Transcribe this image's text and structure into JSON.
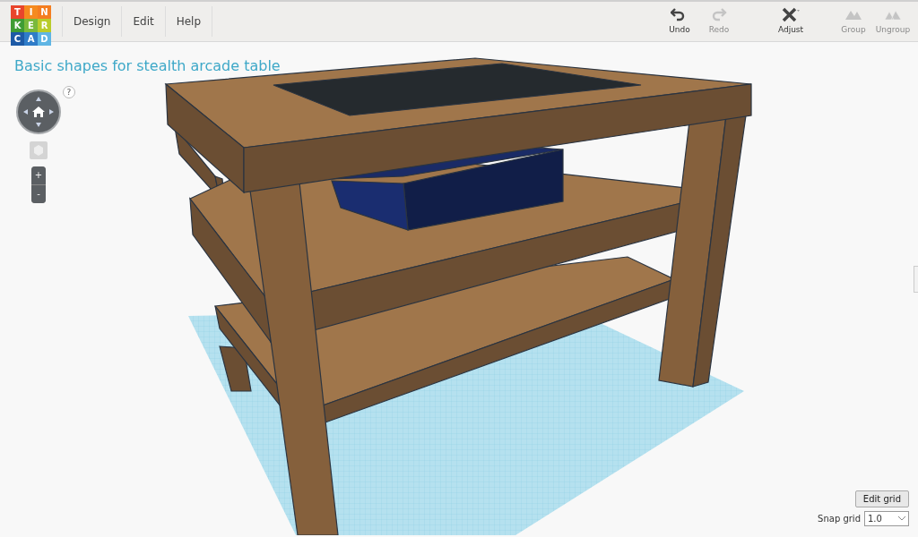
{
  "logo": {
    "letters": [
      {
        "text": "T",
        "color": "#e8452c"
      },
      {
        "text": "I",
        "color": "#f58a1f"
      },
      {
        "text": "N",
        "color": "#f47d20"
      },
      {
        "text": "K",
        "color": "#3f9c35"
      },
      {
        "text": "E",
        "color": "#7ab93c"
      },
      {
        "text": "R",
        "color": "#b9cc2b"
      },
      {
        "text": "C",
        "color": "#1d5aa6"
      },
      {
        "text": "A",
        "color": "#2f7cc8"
      },
      {
        "text": "D",
        "color": "#5fb5e4"
      }
    ]
  },
  "menu": [
    "Design",
    "Edit",
    "Help"
  ],
  "toolbar": [
    {
      "kind": "undo",
      "label": "Undo",
      "disabled": false
    },
    {
      "kind": "redo",
      "label": "Redo",
      "disabled": true
    },
    {
      "kind": "adjust",
      "label": "Adjust",
      "disabled": false
    },
    {
      "kind": "group",
      "label": "Group",
      "disabled": true
    },
    {
      "kind": "ungroup",
      "label": "Ungroup",
      "disabled": true
    }
  ],
  "design_title": "Basic shapes for stealth arcade table",
  "view_controls": {
    "help": "?",
    "zoom_in": "+",
    "zoom_out": "-"
  },
  "grid_controls": {
    "edit_button": "Edit grid",
    "snap_label": "Snap grid",
    "snap_value": "1.0"
  }
}
